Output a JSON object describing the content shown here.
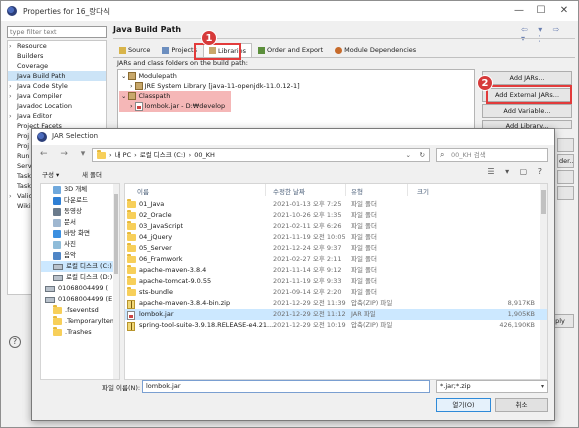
{
  "props_window": {
    "title": "Properties for 16_랑다식",
    "minimize": "—",
    "maximize": "☐",
    "close": "✕",
    "filter_placeholder": "type filter text",
    "nav_items": [
      {
        "label": "Resource",
        "expander": "›"
      },
      {
        "label": "Builders",
        "expander": ""
      },
      {
        "label": "Coverage",
        "expander": ""
      },
      {
        "label": "Java Build Path",
        "expander": ""
      },
      {
        "label": "Java Code Style",
        "expander": "›"
      },
      {
        "label": "Java Compiler",
        "expander": "›"
      },
      {
        "label": "Javadoc Location",
        "expander": ""
      },
      {
        "label": "Java Editor",
        "expander": "›"
      },
      {
        "label": "Project Facets",
        "expander": ""
      },
      {
        "label": "Proj",
        "expander": ""
      },
      {
        "label": "Proj",
        "expander": ""
      },
      {
        "label": "Run",
        "expander": ""
      },
      {
        "label": "Serv",
        "expander": ""
      },
      {
        "label": "Task",
        "expander": ""
      },
      {
        "label": "Task",
        "expander": ""
      },
      {
        "label": "Valic",
        "expander": "›"
      },
      {
        "label": "Wiki",
        "expander": ""
      }
    ],
    "page_title": "Java Build Path",
    "header_nav": "⇦ ▾ ⇨ ▾ ⋮",
    "tabs": [
      {
        "label": "Source",
        "icon": "source-folder-icon"
      },
      {
        "label": "Projects",
        "icon": "projects-icon"
      },
      {
        "label": "Libraries",
        "icon": "libraries-icon"
      },
      {
        "label": "Order and Export",
        "icon": "order-export-icon"
      },
      {
        "label": "Module Dependencies",
        "icon": "module-deps-icon"
      }
    ],
    "content_desc": "JARs and class folders on the build path:",
    "tree": {
      "modulepath": "Modulepath",
      "jre": "JRE System Library [java-11-openjdk-11.0.12-1]",
      "classpath": "Classpath",
      "lombok": "lombok.jar - D:₩develop"
    },
    "buttons": {
      "add_jars": "Add JARs...",
      "add_external_jars": "Add External JARs...",
      "add_variable": "Add Variable...",
      "add_library": "Add Library...",
      "order": "der...",
      "apply": "ply"
    },
    "help": "?"
  },
  "callouts": {
    "one": "1",
    "two": "2",
    "color": "#e23b3b"
  },
  "jar_dialog": {
    "title": "JAR Selection",
    "nav_arrows": "← → ▾ ↑",
    "path": [
      "내 PC",
      "로컬 디스크 (C:)",
      "00_KH"
    ],
    "search_placeholder": "00_KH 검색",
    "organize": "구성 ▾",
    "new_folder": "새 폴더",
    "view_buttons": "☰ ▾ ▢ ?",
    "sidebar": [
      {
        "label": "3D 개체",
        "icon": "3d-objects-icon"
      },
      {
        "label": "다운로드",
        "icon": "download-icon"
      },
      {
        "label": "동영상",
        "icon": "video-icon"
      },
      {
        "label": "문서",
        "icon": "documents-icon"
      },
      {
        "label": "바탕 화면",
        "icon": "desktop-icon"
      },
      {
        "label": "사진",
        "icon": "pictures-icon"
      },
      {
        "label": "음악",
        "icon": "music-icon"
      },
      {
        "label": "로컬 디스크 (C:)",
        "icon": "drive-icon"
      },
      {
        "label": "로컬 디스크 (D:)",
        "icon": "drive-icon"
      },
      {
        "label": "01068004499 (",
        "icon": "phone-drive-icon"
      },
      {
        "label": "01068004499 (E",
        "icon": "usb-drive-icon"
      },
      {
        "label": ".fseventsd",
        "icon": "folder-icon"
      },
      {
        "label": ".Temporaryltem",
        "icon": "folder-icon"
      },
      {
        "label": ".Trashes",
        "icon": "folder-icon"
      }
    ],
    "columns": {
      "name": "이름",
      "modified": "수정한 날짜",
      "type": "유형",
      "size": "크기"
    },
    "files": [
      {
        "name": "01_Java",
        "modified": "2021-01-13 오후 7:25",
        "type": "파일 폴더",
        "size": "",
        "kind": "folder"
      },
      {
        "name": "02_Oracle",
        "modified": "2021-10-26 오후 1:35",
        "type": "파일 폴더",
        "size": "",
        "kind": "folder"
      },
      {
        "name": "03_JavaScript",
        "modified": "2021-02-11 오후 6:26",
        "type": "파일 폴더",
        "size": "",
        "kind": "folder"
      },
      {
        "name": "04_jQuery",
        "modified": "2021-11-19 오전 10:05",
        "type": "파일 폴더",
        "size": "",
        "kind": "folder"
      },
      {
        "name": "05_Server",
        "modified": "2021-12-24 오후 9:37",
        "type": "파일 폴더",
        "size": "",
        "kind": "folder"
      },
      {
        "name": "06_Framwork",
        "modified": "2021-02-27 오후 2:11",
        "type": "파일 폴더",
        "size": "",
        "kind": "folder"
      },
      {
        "name": "apache-maven-3.8.4",
        "modified": "2021-11-14 오후 9:12",
        "type": "파일 폴더",
        "size": "",
        "kind": "folder"
      },
      {
        "name": "apache-tomcat-9.0.55",
        "modified": "2021-11-19 오후 9:33",
        "type": "파일 폴더",
        "size": "",
        "kind": "folder"
      },
      {
        "name": "sts-bundle",
        "modified": "2021-09-14 오후 2:20",
        "type": "파일 폴더",
        "size": "",
        "kind": "folder"
      },
      {
        "name": "apache-maven-3.8.4-bin.zip",
        "modified": "2021-12-29 오전 11:39",
        "type": "압축(ZIP) 파일",
        "size": "8,917KB",
        "kind": "zip"
      },
      {
        "name": "lombok.jar",
        "modified": "2021-12-29 오전 11:12",
        "type": "JAR 파일",
        "size": "1,905KB",
        "kind": "jar"
      },
      {
        "name": "spring-tool-suite-3.9.18.RELEASE-e4.21....",
        "modified": "2021-12-29 오전 10:19",
        "type": "압축(ZIP) 파일",
        "size": "426,190KB",
        "kind": "zip"
      }
    ],
    "filename_label": "파일 이름(N):",
    "filename_value": "lombok.jar",
    "filter_value": "*.jar;*.zip",
    "open": "열기(O)",
    "cancel": "취소"
  }
}
